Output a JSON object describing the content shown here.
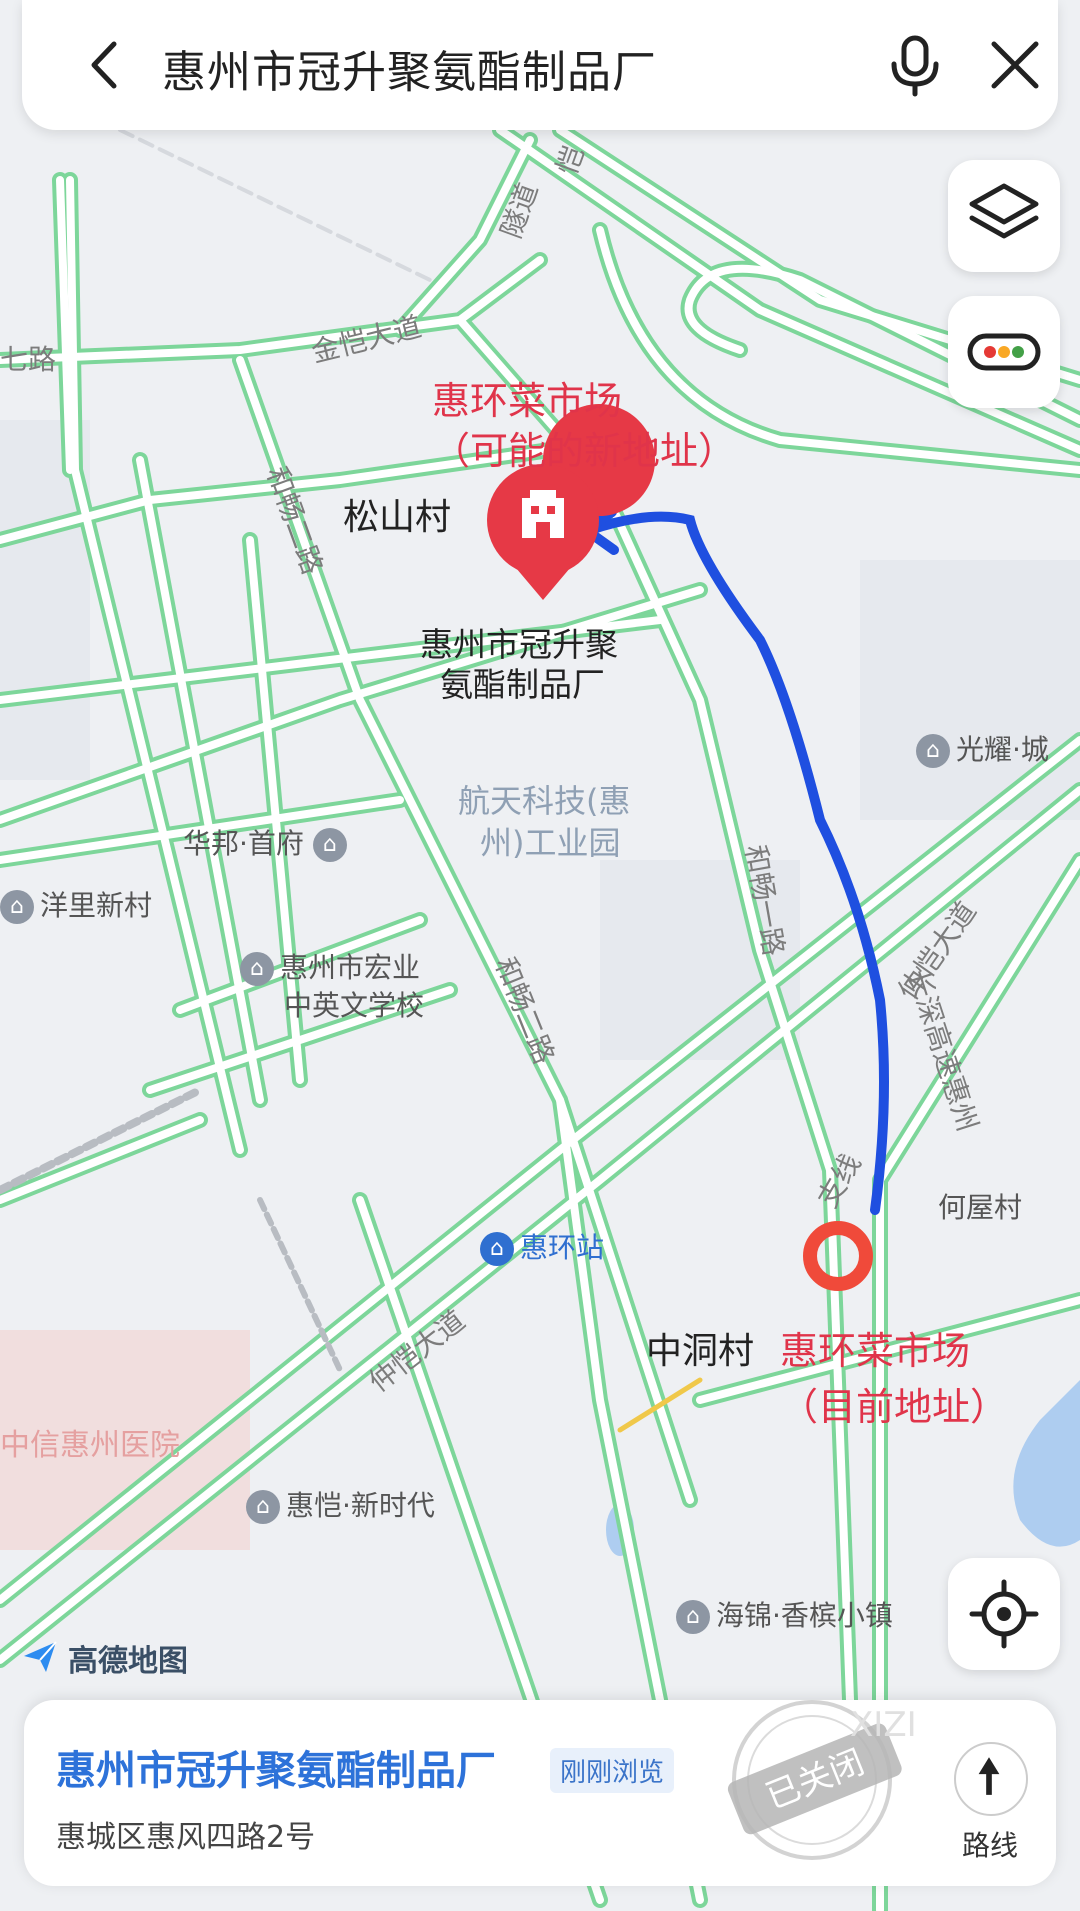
{
  "search": {
    "query": "惠州市冠升聚氨酯制品厂"
  },
  "colors": {
    "road_stroke": "#7dd69a",
    "road_fill": "#ffffff",
    "accent_red": "#e0344a",
    "route_blue": "#1f4fe0",
    "marker_red": "#e63946",
    "title_blue": "#2d72d9"
  },
  "map_labels": {
    "gold_ave_top": "金恺大道",
    "seven_road": "七路",
    "tunnel": "隧道",
    "kai": "恺",
    "market_new_line1": "惠环菜市场",
    "market_new_line2": "（可能的新地址）",
    "songshan": "松山村",
    "target_line1": "惠州市冠升聚",
    "target_line2": "氨酯制品厂",
    "hechang_2_top": "和畅二路",
    "guangyao": "光耀·城",
    "aerospace_line1": "航天科技(惠",
    "aerospace_line2": "州)工业园",
    "huabang": "华邦·首府",
    "yangli": "洋里新村",
    "hechang_1": "和畅一路",
    "school_line1": "惠州市宏业",
    "school_line2": "中英文学校",
    "hechang_2_bottom": "和畅二路",
    "zhongkai_ave_right": "仲恺大道",
    "changshen": "长深高速惠州",
    "branch": "支线",
    "hewu": "何屋村",
    "huanhuan_station": "惠环站",
    "zhongdong": "中洞村",
    "market_now_line1": "惠环菜市场",
    "market_now_line2": "（目前地址）",
    "zhongkai_ave_bottom": "仲恺大道",
    "citic_hospital": "中信惠州医院",
    "huikai": "惠恺·新时代",
    "haijin": "海锦·香槟小镇",
    "map_logo": "高德地图"
  },
  "buttons": {
    "back_icon": "chevron-left-icon",
    "mic_icon": "microphone-icon",
    "close_icon": "close-icon",
    "layers_icon": "layers-icon",
    "traffic_icon": "traffic-light-icon",
    "locate_icon": "locate-icon"
  },
  "card": {
    "title": "惠州市冠升聚氨酯制品厂",
    "badge": "刚刚浏览",
    "address": "惠城区惠风四路2号",
    "route_label": "路线",
    "stamp_text": "已关闭",
    "watermark": "XIZI"
  }
}
